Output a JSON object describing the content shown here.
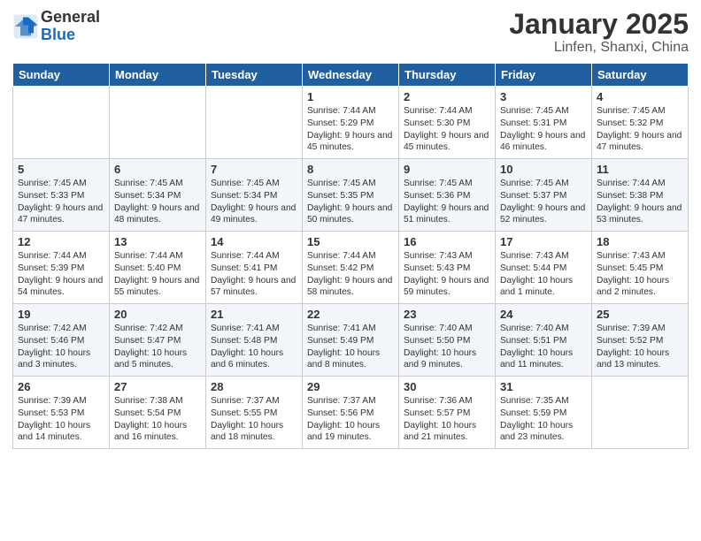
{
  "header": {
    "logo_general": "General",
    "logo_blue": "Blue",
    "month_title": "January 2025",
    "location": "Linfen, Shanxi, China"
  },
  "weekdays": [
    "Sunday",
    "Monday",
    "Tuesday",
    "Wednesday",
    "Thursday",
    "Friday",
    "Saturday"
  ],
  "weeks": [
    [
      {
        "day": "",
        "info": ""
      },
      {
        "day": "",
        "info": ""
      },
      {
        "day": "",
        "info": ""
      },
      {
        "day": "1",
        "info": "Sunrise: 7:44 AM\nSunset: 5:29 PM\nDaylight: 9 hours\nand 45 minutes."
      },
      {
        "day": "2",
        "info": "Sunrise: 7:44 AM\nSunset: 5:30 PM\nDaylight: 9 hours\nand 45 minutes."
      },
      {
        "day": "3",
        "info": "Sunrise: 7:45 AM\nSunset: 5:31 PM\nDaylight: 9 hours\nand 46 minutes."
      },
      {
        "day": "4",
        "info": "Sunrise: 7:45 AM\nSunset: 5:32 PM\nDaylight: 9 hours\nand 47 minutes."
      }
    ],
    [
      {
        "day": "5",
        "info": "Sunrise: 7:45 AM\nSunset: 5:33 PM\nDaylight: 9 hours\nand 47 minutes."
      },
      {
        "day": "6",
        "info": "Sunrise: 7:45 AM\nSunset: 5:34 PM\nDaylight: 9 hours\nand 48 minutes."
      },
      {
        "day": "7",
        "info": "Sunrise: 7:45 AM\nSunset: 5:34 PM\nDaylight: 9 hours\nand 49 minutes."
      },
      {
        "day": "8",
        "info": "Sunrise: 7:45 AM\nSunset: 5:35 PM\nDaylight: 9 hours\nand 50 minutes."
      },
      {
        "day": "9",
        "info": "Sunrise: 7:45 AM\nSunset: 5:36 PM\nDaylight: 9 hours\nand 51 minutes."
      },
      {
        "day": "10",
        "info": "Sunrise: 7:45 AM\nSunset: 5:37 PM\nDaylight: 9 hours\nand 52 minutes."
      },
      {
        "day": "11",
        "info": "Sunrise: 7:44 AM\nSunset: 5:38 PM\nDaylight: 9 hours\nand 53 minutes."
      }
    ],
    [
      {
        "day": "12",
        "info": "Sunrise: 7:44 AM\nSunset: 5:39 PM\nDaylight: 9 hours\nand 54 minutes."
      },
      {
        "day": "13",
        "info": "Sunrise: 7:44 AM\nSunset: 5:40 PM\nDaylight: 9 hours\nand 55 minutes."
      },
      {
        "day": "14",
        "info": "Sunrise: 7:44 AM\nSunset: 5:41 PM\nDaylight: 9 hours\nand 57 minutes."
      },
      {
        "day": "15",
        "info": "Sunrise: 7:44 AM\nSunset: 5:42 PM\nDaylight: 9 hours\nand 58 minutes."
      },
      {
        "day": "16",
        "info": "Sunrise: 7:43 AM\nSunset: 5:43 PM\nDaylight: 9 hours\nand 59 minutes."
      },
      {
        "day": "17",
        "info": "Sunrise: 7:43 AM\nSunset: 5:44 PM\nDaylight: 10 hours\nand 1 minute."
      },
      {
        "day": "18",
        "info": "Sunrise: 7:43 AM\nSunset: 5:45 PM\nDaylight: 10 hours\nand 2 minutes."
      }
    ],
    [
      {
        "day": "19",
        "info": "Sunrise: 7:42 AM\nSunset: 5:46 PM\nDaylight: 10 hours\nand 3 minutes."
      },
      {
        "day": "20",
        "info": "Sunrise: 7:42 AM\nSunset: 5:47 PM\nDaylight: 10 hours\nand 5 minutes."
      },
      {
        "day": "21",
        "info": "Sunrise: 7:41 AM\nSunset: 5:48 PM\nDaylight: 10 hours\nand 6 minutes."
      },
      {
        "day": "22",
        "info": "Sunrise: 7:41 AM\nSunset: 5:49 PM\nDaylight: 10 hours\nand 8 minutes."
      },
      {
        "day": "23",
        "info": "Sunrise: 7:40 AM\nSunset: 5:50 PM\nDaylight: 10 hours\nand 9 minutes."
      },
      {
        "day": "24",
        "info": "Sunrise: 7:40 AM\nSunset: 5:51 PM\nDaylight: 10 hours\nand 11 minutes."
      },
      {
        "day": "25",
        "info": "Sunrise: 7:39 AM\nSunset: 5:52 PM\nDaylight: 10 hours\nand 13 minutes."
      }
    ],
    [
      {
        "day": "26",
        "info": "Sunrise: 7:39 AM\nSunset: 5:53 PM\nDaylight: 10 hours\nand 14 minutes."
      },
      {
        "day": "27",
        "info": "Sunrise: 7:38 AM\nSunset: 5:54 PM\nDaylight: 10 hours\nand 16 minutes."
      },
      {
        "day": "28",
        "info": "Sunrise: 7:37 AM\nSunset: 5:55 PM\nDaylight: 10 hours\nand 18 minutes."
      },
      {
        "day": "29",
        "info": "Sunrise: 7:37 AM\nSunset: 5:56 PM\nDaylight: 10 hours\nand 19 minutes."
      },
      {
        "day": "30",
        "info": "Sunrise: 7:36 AM\nSunset: 5:57 PM\nDaylight: 10 hours\nand 21 minutes."
      },
      {
        "day": "31",
        "info": "Sunrise: 7:35 AM\nSunset: 5:59 PM\nDaylight: 10 hours\nand 23 minutes."
      },
      {
        "day": "",
        "info": ""
      }
    ]
  ]
}
